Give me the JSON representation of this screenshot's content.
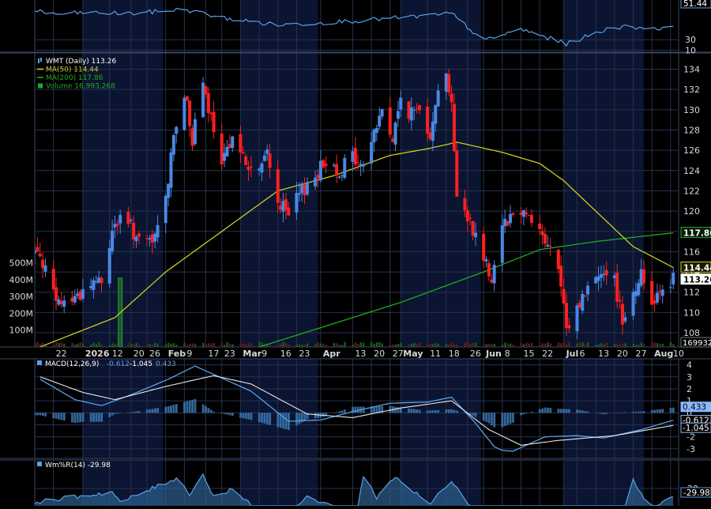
{
  "colors": {
    "background": "#000000",
    "panel_blue": "#0b1430",
    "grid": "#26324f",
    "candle_up": "#4a88e6",
    "candle_down": "#ff2020",
    "ma50": "#cccc22",
    "ma200": "#22aa22",
    "indicator_line": "#5aa0e8",
    "white_line": "#e8e8e8",
    "text": "#d8d8d8"
  },
  "chart_data": [
    {
      "type": "candlestick",
      "title": "WMT (Daily)",
      "legend": [
        {
          "id": "price",
          "label": "WMT (Daily) 113.26",
          "color": "#5aa0ff",
          "icon": "candle-icon"
        },
        {
          "id": "ma50",
          "label": "MA(50) 114.44",
          "color": "#cccc22",
          "icon": "line-icon"
        },
        {
          "id": "ma200",
          "label": "MA(200) 117.86",
          "color": "#22aa22",
          "icon": "line-icon"
        },
        {
          "id": "volume",
          "label": "Volume 16,993,268",
          "color": "#22aa22",
          "icon": "bar-icon"
        }
      ],
      "price_axis": {
        "ticks": [
          "134",
          "132",
          "130",
          "128",
          "126",
          "124",
          "122",
          "120",
          "118",
          "116",
          "114",
          "112",
          "110",
          "108"
        ],
        "min": 106.6,
        "max": 135.6
      },
      "volume_axis": {
        "ticks": [
          "500M",
          "400M",
          "300M",
          "200M",
          "100M"
        ],
        "max": 630
      },
      "x_tick_labels": [
        {
          "label": "22",
          "major": false,
          "date": "2025-12-22"
        },
        {
          "label": "2026",
          "major": true,
          "date": "2026-01-02"
        },
        {
          "label": "12",
          "major": false,
          "date": "2026-01-12"
        },
        {
          "label": "20",
          "major": false,
          "date": "2026-01-20"
        },
        {
          "label": "26",
          "major": false,
          "date": "2026-01-26"
        },
        {
          "label": "Feb",
          "major": true,
          "date": "2026-02-02"
        },
        {
          "label": "9",
          "major": false,
          "date": "2026-02-09"
        },
        {
          "label": "17",
          "major": false,
          "date": "2026-02-17"
        },
        {
          "label": "23",
          "major": false,
          "date": "2026-02-23"
        },
        {
          "label": "Mar",
          "major": true,
          "date": "2026-03-02"
        },
        {
          "label": "9",
          "major": false,
          "date": "2026-03-09"
        },
        {
          "label": "16",
          "major": false,
          "date": "2026-03-16"
        },
        {
          "label": "23",
          "major": false,
          "date": "2026-03-23"
        },
        {
          "label": "Apr",
          "major": true,
          "date": "2026-04-01"
        },
        {
          "label": "13",
          "major": false,
          "date": "2026-04-13"
        },
        {
          "label": "20",
          "major": false,
          "date": "2026-04-20"
        },
        {
          "label": "27",
          "major": false,
          "date": "2026-04-27"
        },
        {
          "label": "May",
          "major": true,
          "date": "2026-05-01"
        },
        {
          "label": "11",
          "major": false,
          "date": "2026-05-11"
        },
        {
          "label": "18",
          "major": false,
          "date": "2026-05-18"
        },
        {
          "label": "26",
          "major": false,
          "date": "2026-05-26"
        },
        {
          "label": "Jun",
          "major": true,
          "date": "2026-06-01"
        },
        {
          "label": "8",
          "major": false,
          "date": "2026-06-08"
        },
        {
          "label": "15",
          "major": false,
          "date": "2026-06-15"
        },
        {
          "label": "22",
          "major": false,
          "date": "2026-06-22"
        },
        {
          "label": "Jul",
          "major": true,
          "date": "2026-07-01"
        },
        {
          "label": "6",
          "major": false,
          "date": "2026-07-06"
        },
        {
          "label": "13",
          "major": false,
          "date": "2026-07-13"
        },
        {
          "label": "20",
          "major": false,
          "date": "2026-07-20"
        },
        {
          "label": "27",
          "major": false,
          "date": "2026-07-27"
        },
        {
          "label": "Aug",
          "major": true,
          "date": "2026-08-03"
        },
        {
          "label": "10",
          "major": false,
          "date": "2026-08-10"
        }
      ],
      "shaded_months": [
        {
          "start": "2026-01-02",
          "end": "2026-02-01"
        },
        {
          "start": "2026-03-02",
          "end": "2026-03-31"
        },
        {
          "start": "2026-05-01",
          "end": "2026-05-31"
        },
        {
          "start": "2026-07-01",
          "end": "2026-07-31"
        }
      ],
      "anchors": [
        {
          "date": "2025-12-17",
          "close": 116.0
        },
        {
          "date": "2025-12-23",
          "close": 110.8
        },
        {
          "date": "2025-12-30",
          "close": 111.5
        },
        {
          "date": "2026-01-07",
          "close": 113.2
        },
        {
          "date": "2026-01-09",
          "close": 112.6
        },
        {
          "date": "2026-01-13",
          "close": 118.2
        },
        {
          "date": "2026-01-15",
          "close": 119.0
        },
        {
          "date": "2026-01-20",
          "close": 118.5
        },
        {
          "date": "2026-01-23",
          "close": 116.8
        },
        {
          "date": "2026-01-28",
          "close": 116.8
        },
        {
          "date": "2026-02-02",
          "close": 121.0
        },
        {
          "date": "2026-02-05",
          "close": 128.0
        },
        {
          "date": "2026-02-10",
          "close": 131.0
        },
        {
          "date": "2026-02-12",
          "close": 127.0
        },
        {
          "date": "2026-02-16",
          "close": 132.2
        },
        {
          "date": "2026-02-19",
          "close": 129.0
        },
        {
          "date": "2026-02-23",
          "close": 124.0
        },
        {
          "date": "2026-02-27",
          "close": 128.0
        },
        {
          "date": "2026-03-04",
          "close": 124.5
        },
        {
          "date": "2026-03-09",
          "close": 123.8
        },
        {
          "date": "2026-03-12",
          "close": 125.8
        },
        {
          "date": "2026-03-16",
          "close": 121.0
        },
        {
          "date": "2026-03-20",
          "close": 119.5
        },
        {
          "date": "2026-03-25",
          "close": 122.0
        },
        {
          "date": "2026-03-30",
          "close": 123.5
        },
        {
          "date": "2026-04-03",
          "close": 125.0
        },
        {
          "date": "2026-04-08",
          "close": 124.0
        },
        {
          "date": "2026-04-13",
          "close": 125.5
        },
        {
          "date": "2026-04-16",
          "close": 124.2
        },
        {
          "date": "2026-04-20",
          "close": 127.0
        },
        {
          "date": "2026-04-24",
          "close": 130.0
        },
        {
          "date": "2026-04-28",
          "close": 127.0
        },
        {
          "date": "2026-05-01",
          "close": 131.0
        },
        {
          "date": "2026-05-05",
          "close": 129.5
        },
        {
          "date": "2026-05-08",
          "close": 130.2
        },
        {
          "date": "2026-05-12",
          "close": 127.8
        },
        {
          "date": "2026-05-14",
          "close": 131.0
        },
        {
          "date": "2026-05-18",
          "close": 133.5
        },
        {
          "date": "2026-05-20",
          "close": 131.0
        },
        {
          "date": "2026-05-22",
          "close": 121.0
        },
        {
          "date": "2026-05-27",
          "close": 119.0
        },
        {
          "date": "2026-06-01",
          "close": 115.5
        },
        {
          "date": "2026-06-04",
          "close": 113.5
        },
        {
          "date": "2026-06-08",
          "close": 119.0
        },
        {
          "date": "2026-06-11",
          "close": 119.5
        },
        {
          "date": "2026-06-15",
          "close": 120.2
        },
        {
          "date": "2026-06-18",
          "close": 119.8
        },
        {
          "date": "2026-06-22",
          "close": 118.0
        },
        {
          "date": "2026-06-25",
          "close": 116.5
        },
        {
          "date": "2026-06-29",
          "close": 114.5
        },
        {
          "date": "2026-07-02",
          "close": 108.0
        },
        {
          "date": "2026-07-06",
          "close": 110.5
        },
        {
          "date": "2026-07-09",
          "close": 112.0
        },
        {
          "date": "2026-07-13",
          "close": 113.5
        },
        {
          "date": "2026-07-16",
          "close": 114.5
        },
        {
          "date": "2026-07-20",
          "close": 113.0
        },
        {
          "date": "2026-07-23",
          "close": 109.5
        },
        {
          "date": "2026-07-27",
          "close": 112.0
        },
        {
          "date": "2026-07-30",
          "close": 113.8
        },
        {
          "date": "2026-08-03",
          "close": 111.0
        },
        {
          "date": "2026-08-06",
          "close": 112.5
        },
        {
          "date": "2026-08-11",
          "close": 113.26
        }
      ],
      "volume_spike": {
        "date": "2026-01-16",
        "value": 410
      },
      "ma50_points": [
        {
          "date": "2025-12-17",
          "value": 106.6
        },
        {
          "date": "2026-01-14",
          "value": 109.5
        },
        {
          "date": "2026-02-02",
          "value": 114.0
        },
        {
          "date": "2026-02-23",
          "value": 118.0
        },
        {
          "date": "2026-03-16",
          "value": 122.0
        },
        {
          "date": "2026-04-06",
          "value": 123.5
        },
        {
          "date": "2026-04-27",
          "value": 125.5
        },
        {
          "date": "2026-05-12",
          "value": 126.2
        },
        {
          "date": "2026-05-22",
          "value": 126.8
        },
        {
          "date": "2026-06-08",
          "value": 125.8
        },
        {
          "date": "2026-06-22",
          "value": 124.7
        },
        {
          "date": "2026-07-01",
          "value": 123.0
        },
        {
          "date": "2026-07-13",
          "value": 120.0
        },
        {
          "date": "2026-07-27",
          "value": 116.5
        },
        {
          "date": "2026-08-11",
          "value": 114.44
        }
      ],
      "ma200_points": [
        {
          "date": "2026-03-09",
          "value": 106.6
        },
        {
          "date": "2026-04-01",
          "value": 108.5
        },
        {
          "date": "2026-05-01",
          "value": 111.0
        },
        {
          "date": "2026-06-01",
          "value": 114.0
        },
        {
          "date": "2026-06-22",
          "value": 116.2
        },
        {
          "date": "2026-07-13",
          "value": 117.0
        },
        {
          "date": "2026-08-11",
          "value": 117.86
        }
      ],
      "price_markers": [
        {
          "label": "117.86",
          "value": 117.86,
          "bg": "#0a1a0a",
          "color": "#ffffff",
          "border": "#22aa22"
        },
        {
          "label": "114.44",
          "value": 114.44,
          "bg": "#1a1a00",
          "color": "#ffffff",
          "border": "#cccc22"
        },
        {
          "label": "113.26",
          "value": 113.26,
          "bg": "#ffffff",
          "color": "#000000",
          "border": "#ffffff"
        }
      ],
      "volume_marker": "169932"
    },
    {
      "type": "line",
      "title": "RSI",
      "y_ticks": [
        "30",
        "10"
      ],
      "value_label": "51.44",
      "min": 0,
      "max": 100,
      "anchors": [
        {
          "date": "2025-12-17",
          "value": 85
        },
        {
          "date": "2025-12-22",
          "value": 78
        },
        {
          "date": "2026-01-02",
          "value": 82
        },
        {
          "date": "2026-01-20",
          "value": 80
        },
        {
          "date": "2026-02-09",
          "value": 88
        },
        {
          "date": "2026-02-23",
          "value": 72
        },
        {
          "date": "2026-03-16",
          "value": 58
        },
        {
          "date": "2026-04-13",
          "value": 66
        },
        {
          "date": "2026-05-01",
          "value": 72
        },
        {
          "date": "2026-05-20",
          "value": 80
        },
        {
          "date": "2026-06-01",
          "value": 28
        },
        {
          "date": "2026-06-15",
          "value": 50
        },
        {
          "date": "2026-07-02",
          "value": 22
        },
        {
          "date": "2026-07-20",
          "value": 55
        },
        {
          "date": "2026-08-11",
          "value": 51.44
        }
      ]
    },
    {
      "type": "line",
      "title": "MACD(12,26,9)",
      "legend_label": "MACD(12,26,9)",
      "legend_values": [
        "-0.612",
        "-1.045",
        "0.433"
      ],
      "y_ticks": [
        "4",
        "3",
        "2",
        "1",
        "0",
        "-1",
        "-2",
        "-3"
      ],
      "min": -3.8,
      "max": 4.5,
      "macd_anchors": [
        {
          "date": "2025-12-17",
          "value": 2.8
        },
        {
          "date": "2025-12-30",
          "value": 1.1
        },
        {
          "date": "2026-01-09",
          "value": 0.6
        },
        {
          "date": "2026-01-20",
          "value": 1.5
        },
        {
          "date": "2026-02-03",
          "value": 2.8
        },
        {
          "date": "2026-02-13",
          "value": 3.9
        },
        {
          "date": "2026-02-23",
          "value": 2.9
        },
        {
          "date": "2026-03-06",
          "value": 1.8
        },
        {
          "date": "2026-03-20",
          "value": -0.7
        },
        {
          "date": "2026-04-01",
          "value": -0.6
        },
        {
          "date": "2026-04-13",
          "value": 0.1
        },
        {
          "date": "2026-04-27",
          "value": 0.8
        },
        {
          "date": "2026-05-11",
          "value": 0.9
        },
        {
          "date": "2026-05-20",
          "value": 1.3
        },
        {
          "date": "2026-05-28",
          "value": -0.6
        },
        {
          "date": "2026-06-06",
          "value": -3.1
        },
        {
          "date": "2026-06-12",
          "value": -3.2
        },
        {
          "date": "2026-06-24",
          "value": -2.0
        },
        {
          "date": "2026-07-06",
          "value": -1.9
        },
        {
          "date": "2026-07-16",
          "value": -2.1
        },
        {
          "date": "2026-07-30",
          "value": -1.4
        },
        {
          "date": "2026-08-11",
          "value": -0.612
        }
      ],
      "signal_anchors": [
        {
          "date": "2025-12-17",
          "value": 3.0
        },
        {
          "date": "2026-01-02",
          "value": 1.7
        },
        {
          "date": "2026-01-14",
          "value": 1.1
        },
        {
          "date": "2026-02-02",
          "value": 2.2
        },
        {
          "date": "2026-02-20",
          "value": 3.1
        },
        {
          "date": "2026-03-06",
          "value": 2.4
        },
        {
          "date": "2026-03-27",
          "value": -0.1
        },
        {
          "date": "2026-04-13",
          "value": -0.4
        },
        {
          "date": "2026-05-01",
          "value": 0.4
        },
        {
          "date": "2026-05-20",
          "value": 1.0
        },
        {
          "date": "2026-06-03",
          "value": -1.4
        },
        {
          "date": "2026-06-15",
          "value": -2.7
        },
        {
          "date": "2026-06-29",
          "value": -2.3
        },
        {
          "date": "2026-07-20",
          "value": -1.9
        },
        {
          "date": "2026-08-11",
          "value": -1.045
        }
      ],
      "markers": [
        {
          "label": "0.433",
          "value": 0.433,
          "bg": "#8ab8ff",
          "color": "#000000"
        },
        {
          "label": "-0.612",
          "value": -0.612,
          "bg": "#000000",
          "color": "#ffffff"
        },
        {
          "label": "-1.045",
          "value": -1.045,
          "bg": "#000000",
          "color": "#ffffff"
        }
      ]
    },
    {
      "type": "area",
      "title": "Wm%R(14)",
      "legend_label": "Wm%R(14) -29.98",
      "y_ticks": [
        "-20"
      ],
      "min": -40,
      "max": 0,
      "value_label": "-29.98",
      "anchors": [
        {
          "date": "2025-12-17",
          "value": -35
        },
        {
          "date": "2026-01-13",
          "value": -24
        },
        {
          "date": "2026-01-16",
          "value": -36
        },
        {
          "date": "2026-02-06",
          "value": -8
        },
        {
          "date": "2026-02-11",
          "value": -26
        },
        {
          "date": "2026-02-16",
          "value": -4
        },
        {
          "date": "2026-02-20",
          "value": -30
        },
        {
          "date": "2026-02-27",
          "value": -20
        },
        {
          "date": "2026-03-06",
          "value": -40
        },
        {
          "date": "2026-03-23",
          "value": -40
        },
        {
          "date": "2026-03-27",
          "value": -30
        },
        {
          "date": "2026-04-06",
          "value": -40
        },
        {
          "date": "2026-04-15",
          "value": -40
        },
        {
          "date": "2026-04-17",
          "value": -5
        },
        {
          "date": "2026-04-22",
          "value": -30
        },
        {
          "date": "2026-04-29",
          "value": -6
        },
        {
          "date": "2026-05-05",
          "value": -22
        },
        {
          "date": "2026-05-12",
          "value": -38
        },
        {
          "date": "2026-05-20",
          "value": -10
        },
        {
          "date": "2026-05-27",
          "value": -40
        },
        {
          "date": "2026-07-24",
          "value": -40
        },
        {
          "date": "2026-07-27",
          "value": -8
        },
        {
          "date": "2026-07-31",
          "value": -33
        },
        {
          "date": "2026-08-04",
          "value": -40
        },
        {
          "date": "2026-08-10",
          "value": -29.98
        }
      ]
    }
  ]
}
